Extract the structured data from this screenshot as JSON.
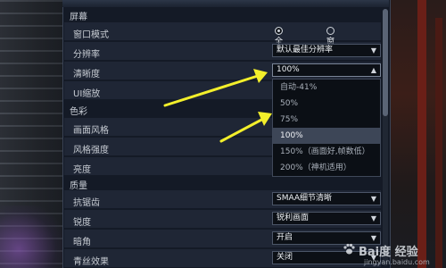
{
  "sections": {
    "screen": "屏幕",
    "color": "色彩",
    "quality": "质量"
  },
  "rows": {
    "window_mode": {
      "label": "窗口模式",
      "opt_fullscreen": "全屏",
      "opt_window": "窗口",
      "selected": "全屏"
    },
    "resolution": {
      "label": "分辨率",
      "value": "默认最佳分辨率"
    },
    "clarity": {
      "label": "清晰度",
      "value": "100%"
    },
    "ui_scale": {
      "label": "UI缩放"
    },
    "picture_style": {
      "label": "画面风格"
    },
    "style_strength": {
      "label": "风格强度"
    },
    "brightness": {
      "label": "亮度"
    },
    "antialias": {
      "label": "抗锯齿",
      "value": "SMAA细节清晰"
    },
    "sharpness": {
      "label": "锐度",
      "value": "锐利画面"
    },
    "vignette": {
      "label": "暗角",
      "value": "开启"
    },
    "hair_effect": {
      "label": "青丝效果",
      "value": "关闭"
    }
  },
  "clarity_dropdown": {
    "options": [
      "自动-41%",
      "50%",
      "75%",
      "100%",
      "150%（画面好,帧数低）",
      "200%（神机适用）"
    ],
    "selected": "100%"
  },
  "watermark": {
    "text": "Bai度 经验",
    "sub": "jingyan.baidu.com"
  },
  "colors": {
    "arrow": "#f3ef2b",
    "panel": "#141b26",
    "selected_option": "#3d4657"
  }
}
